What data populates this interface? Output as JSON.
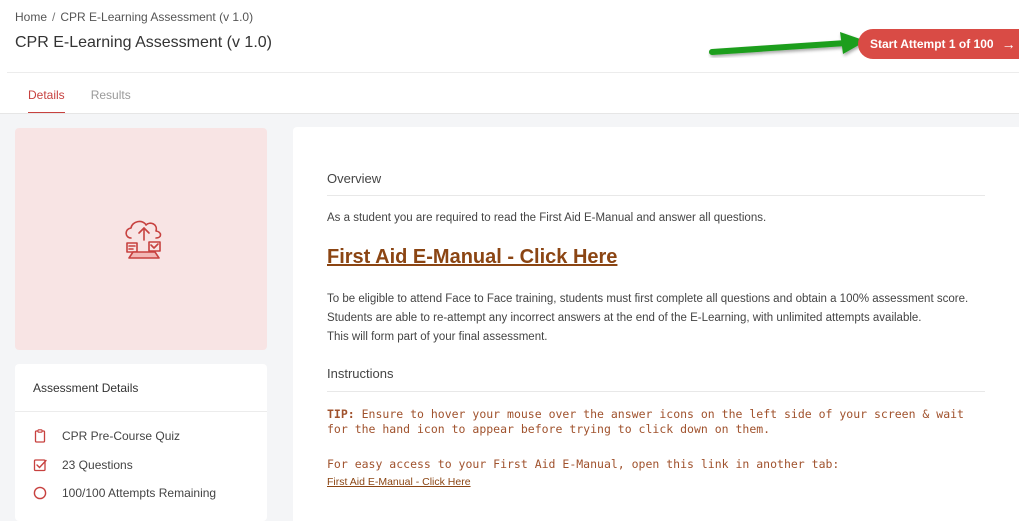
{
  "breadcrumb": {
    "home": "Home",
    "separator": "/",
    "current": "CPR E-Learning Assessment (v 1.0)"
  },
  "page": {
    "title": "CPR E-Learning Assessment (v 1.0)"
  },
  "actions": {
    "start_label": "Start Attempt 1 of 100",
    "start_arrow": "→"
  },
  "tabs": [
    {
      "label": "Details",
      "active": true
    },
    {
      "label": "Results",
      "active": false
    }
  ],
  "assessment_details": {
    "heading": "Assessment Details",
    "items": [
      {
        "icon": "clipboard-icon",
        "label": "CPR Pre-Course Quiz"
      },
      {
        "icon": "checkbox-icon",
        "label": "23 Questions"
      },
      {
        "icon": "circle-icon",
        "label": "100/100 Attempts Remaining"
      }
    ]
  },
  "overview": {
    "heading": "Overview",
    "intro": "As a student you are required to read the First Aid E-Manual and answer all questions.",
    "manual_link": "First Aid E-Manual - Click Here",
    "para_line1": "To be eligible to attend Face to Face training, students must first complete all questions and obtain a 100% assessment score.",
    "para_line2": "Students are able to re-attempt any incorrect answers at the end of the E-Learning, with unlimited attempts available.",
    "para_line3": "This will form part of your final assessment."
  },
  "instructions": {
    "heading": "Instructions",
    "tip_label": "TIP:",
    "tip_text": " Ensure to hover your mouse over the answer icons on the left side of your screen & wait for the hand icon to appear before trying to click down on them.",
    "easy_access": "For easy access to your First Aid E-Manual, open this link in another tab:",
    "small_link": "First Aid E-Manual - Click Here"
  },
  "colors": {
    "accent": "#d94b45",
    "link": "#8b4513",
    "image_bg": "#f8e4e4",
    "annotation_arrow": "#1e9e1e"
  }
}
